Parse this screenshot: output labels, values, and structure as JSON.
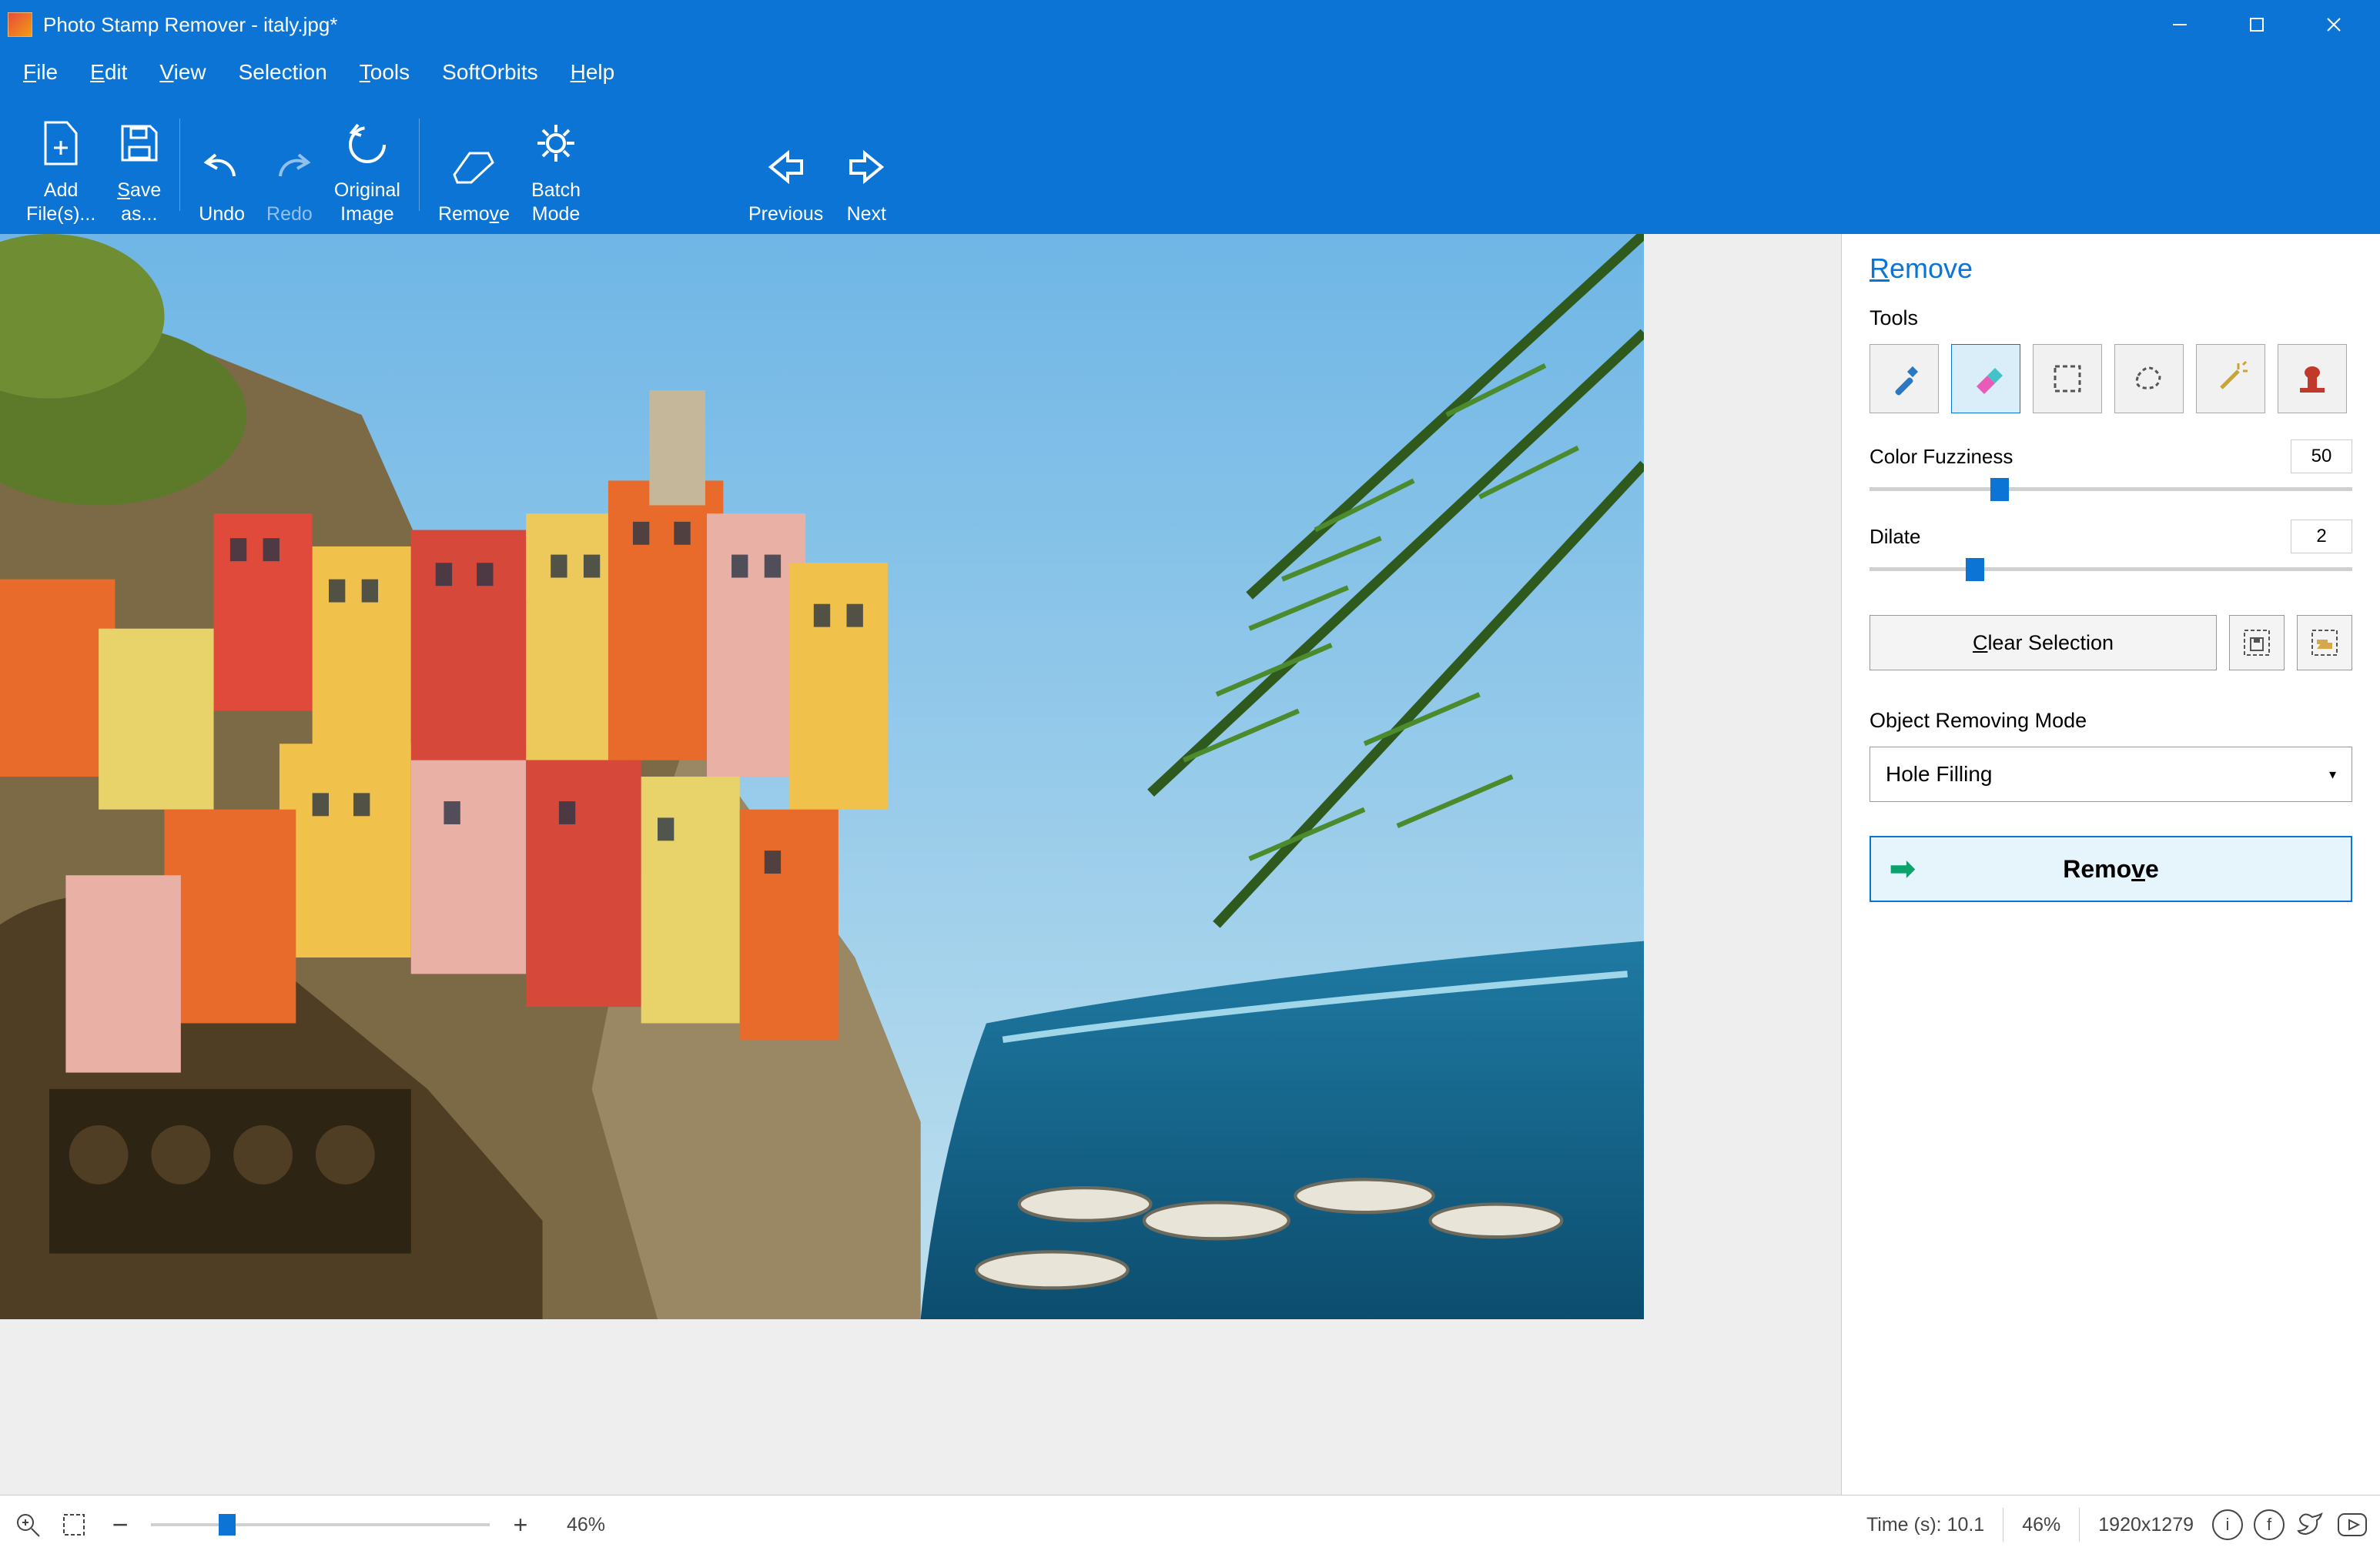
{
  "title": "Photo Stamp Remover - italy.jpg*",
  "menus": [
    "File",
    "Edit",
    "View",
    "Selection",
    "Tools",
    "SoftOrbits",
    "Help"
  ],
  "toolbar": {
    "add_files": "Add File(s)...",
    "save_as": "Save as...",
    "undo": "Undo",
    "redo": "Redo",
    "original": "Original Image",
    "remove": "Remove",
    "batch": "Batch Mode",
    "prev": "Previous",
    "next": "Next"
  },
  "panel": {
    "title": "Remove",
    "tools_label": "Tools",
    "color_fuzziness": {
      "label": "Color Fuzziness",
      "value": "50",
      "pos_pct": 25
    },
    "dilate": {
      "label": "Dilate",
      "value": "2",
      "pos_pct": 20
    },
    "clear_selection": "Clear Selection",
    "mode_label": "Object Removing Mode",
    "mode_value": "Hole Filling",
    "remove_button": "Remove"
  },
  "status": {
    "zoom_left": "46%",
    "time": "Time (s): 10.1",
    "zoom_right": "46%",
    "dimensions": "1920x1279"
  }
}
